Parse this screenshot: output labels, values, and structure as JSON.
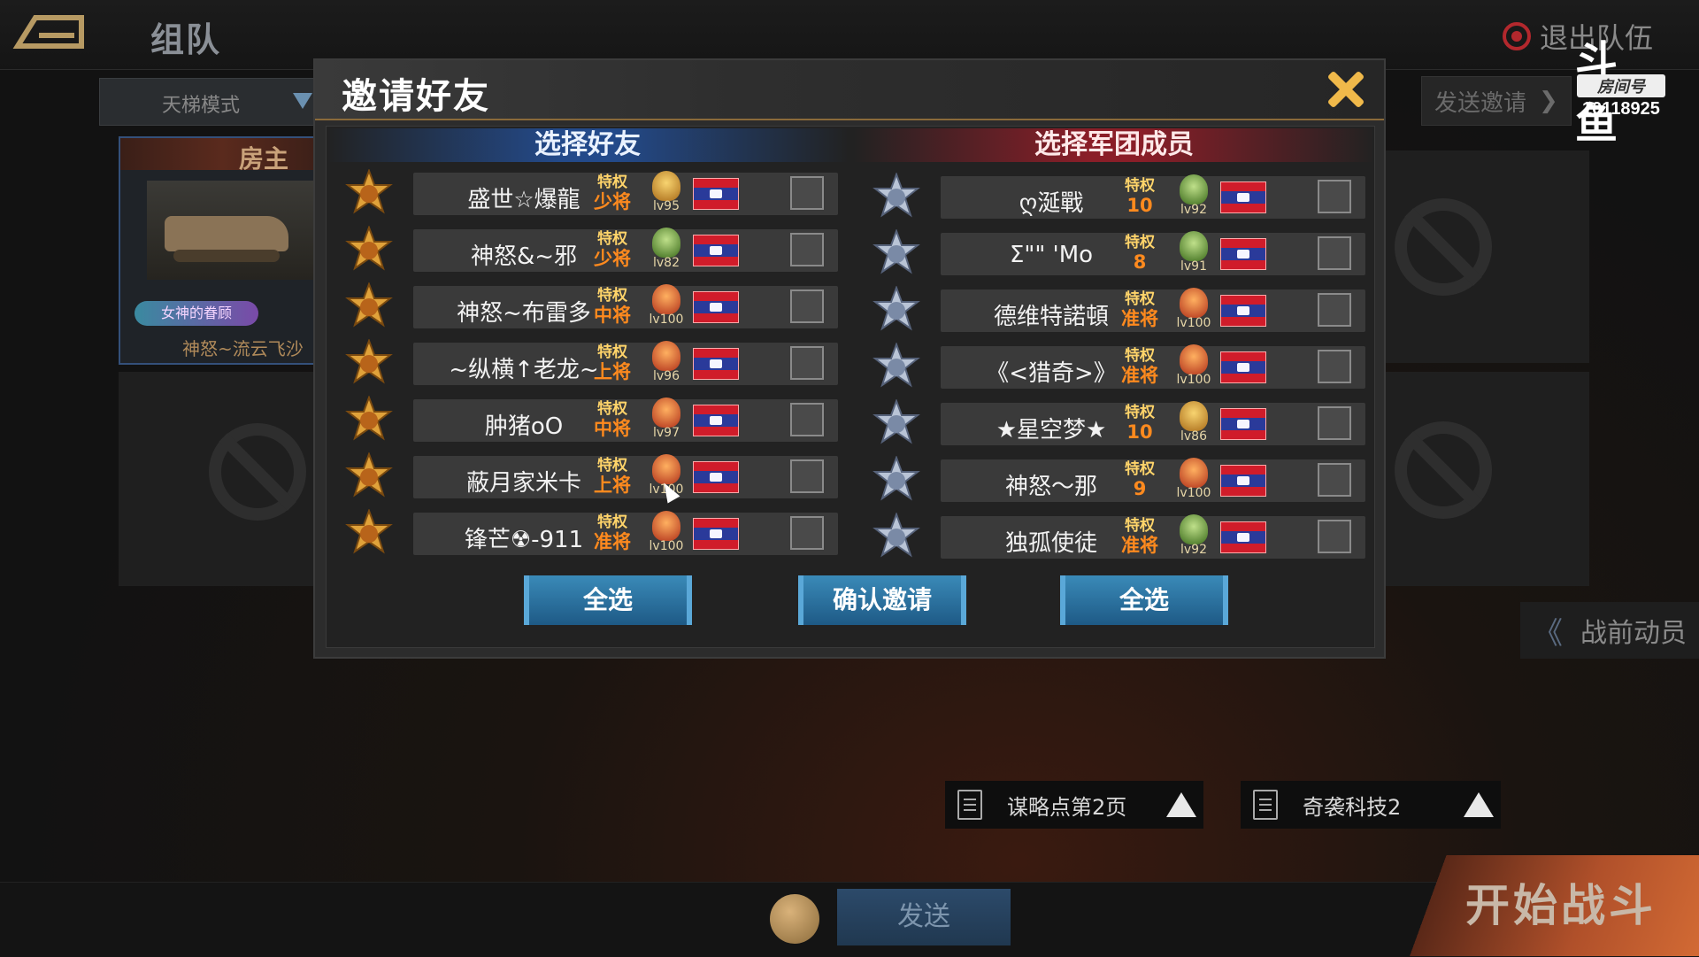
{
  "topbar": {
    "title": "组队",
    "exit_label": "退出队伍",
    "douyu_logo": "斗鱼",
    "room_label": "房间号",
    "room_number": "10118925"
  },
  "mode": {
    "value": "天梯模式"
  },
  "send_invite_bg": "发送邀请",
  "host": {
    "title": "房主",
    "badge": "女神的眷顾",
    "name": "神怒~流云飞沙"
  },
  "modal": {
    "title": "邀请好友",
    "friends_header": "选择好友",
    "legion_header": "选择军团成员",
    "friends": [
      {
        "name": "盛世☆爆龍",
        "badge_top": "特权",
        "badge_rank": "少将",
        "level": "lv95",
        "emblem": "gold"
      },
      {
        "name": "神怒&~邪",
        "badge_top": "特权",
        "badge_rank": "少将",
        "level": "lv82",
        "emblem": "green"
      },
      {
        "name": "神怒~布雷多",
        "badge_top": "特权",
        "badge_rank": "中将",
        "level": "lv100",
        "emblem": "red"
      },
      {
        "name": "~纵横↑老龙~",
        "badge_top": "特权",
        "badge_rank": "上将",
        "level": "lv96",
        "emblem": "red"
      },
      {
        "name": "肿猪oO",
        "badge_top": "特权",
        "badge_rank": "中将",
        "level": "lv97",
        "emblem": "red"
      },
      {
        "name": "蔽月家米卡",
        "badge_top": "特权",
        "badge_rank": "上将",
        "level": "lv100",
        "emblem": "red"
      },
      {
        "name": "锋芒☢-911",
        "badge_top": "特权",
        "badge_rank": "准将",
        "level": "lv100",
        "emblem": "red"
      }
    ],
    "legion": [
      {
        "name": "ღ涎戰",
        "badge_top": "特权",
        "badge_rank": "10",
        "level": "lv92",
        "emblem": "green"
      },
      {
        "name": "Σ\"\" 'Mo",
        "badge_top": "特权",
        "badge_rank": "8",
        "level": "lv91",
        "emblem": "green"
      },
      {
        "name": "德维特諾頓",
        "badge_top": "特权",
        "badge_rank": "准将",
        "level": "lv100",
        "emblem": "red"
      },
      {
        "name": "《<猎奇>》",
        "badge_top": "特权",
        "badge_rank": "准将",
        "level": "lv100",
        "emblem": "red"
      },
      {
        "name": "★星空梦★",
        "badge_top": "特权",
        "badge_rank": "10",
        "level": "lv86",
        "emblem": "gold"
      },
      {
        "name": "神怒～那",
        "badge_top": "特权",
        "badge_rank": "9",
        "level": "lv100",
        "emblem": "red"
      },
      {
        "name": "独孤使徒",
        "badge_top": "特权",
        "badge_rank": "准将",
        "level": "lv92",
        "emblem": "green"
      }
    ],
    "select_all_left": "全选",
    "confirm": "确认邀请",
    "select_all_right": "全选"
  },
  "mobilize": "战前动员",
  "strategy": [
    {
      "label": "谋略点第2页"
    },
    {
      "label": "奇袭科技2"
    }
  ],
  "chat": {
    "send": "发送"
  },
  "start_battle": "开始战斗"
}
